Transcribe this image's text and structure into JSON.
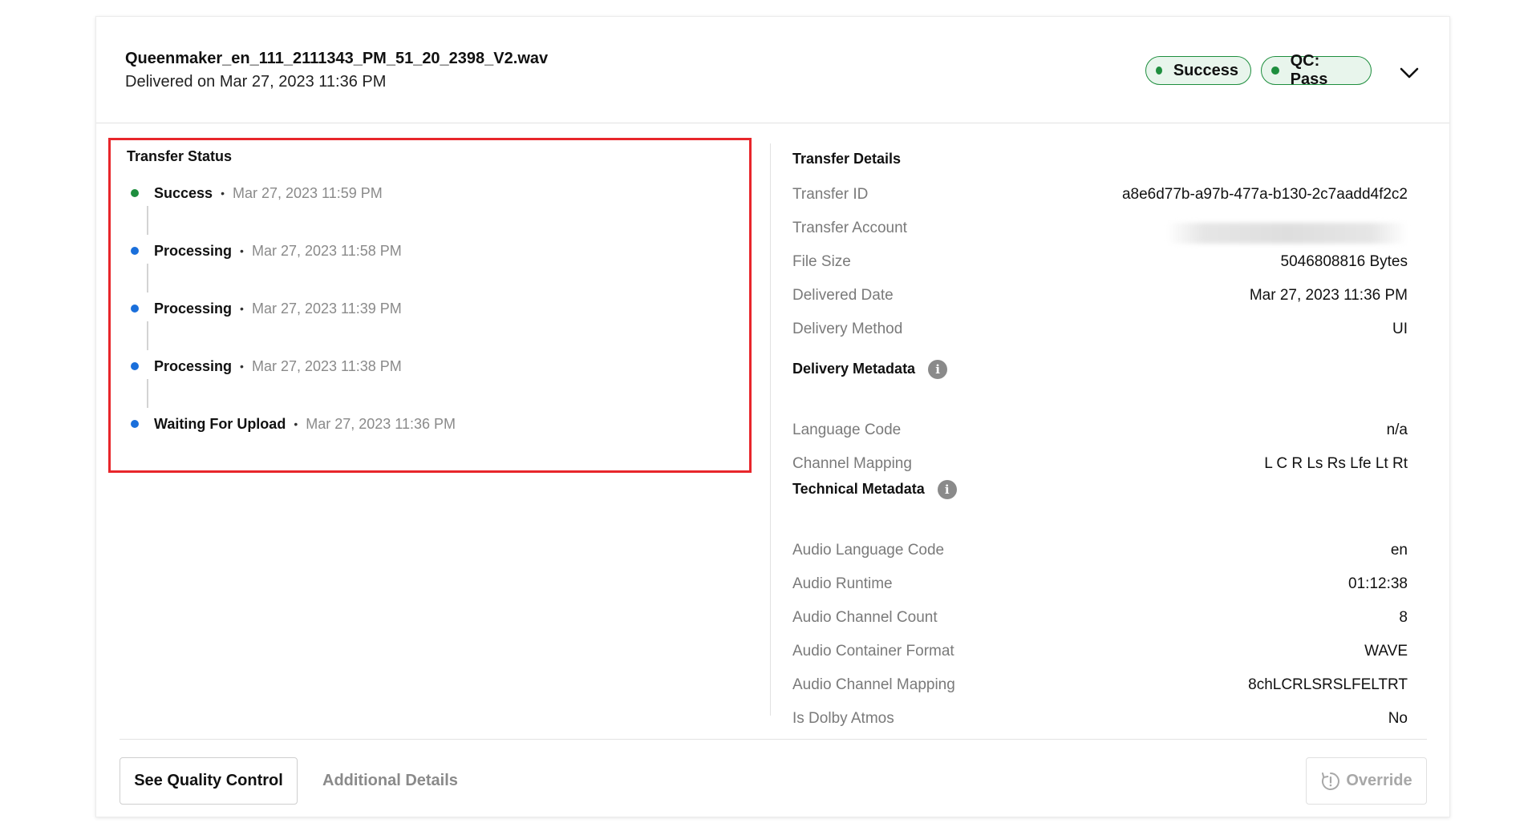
{
  "header": {
    "file_name": "Queenmaker_en_111_2111343_PM_51_20_2398_V2.wav",
    "delivered_on": "Delivered on Mar 27, 2023 11:36 PM",
    "badges": [
      {
        "label": "Success",
        "color": "#1e8e3e"
      },
      {
        "label": "QC: Pass",
        "color": "#1e8e3e"
      }
    ],
    "expand_icon": "chevron-down-icon"
  },
  "transfer_status": {
    "title": "Transfer Status",
    "items": [
      {
        "label": "Success",
        "separator": "•",
        "time": "Mar 27, 2023 11:59 PM",
        "dot_color": "#1e8e3e"
      },
      {
        "label": "Processing",
        "separator": "•",
        "time": "Mar 27, 2023 11:58 PM",
        "dot_color": "#1a6fdb"
      },
      {
        "label": "Processing",
        "separator": "•",
        "time": "Mar 27, 2023 11:39 PM",
        "dot_color": "#1a6fdb"
      },
      {
        "label": "Processing",
        "separator": "•",
        "time": "Mar 27, 2023 11:38 PM",
        "dot_color": "#1a6fdb"
      },
      {
        "label": "Waiting For Upload",
        "separator": "•",
        "time": "Mar 27, 2023 11:36 PM",
        "dot_color": "#1a6fdb"
      }
    ]
  },
  "transfer_details": {
    "title": "Transfer Details",
    "rows": [
      {
        "key": "Transfer ID",
        "value": "a8e6d77b-a97b-477a-b130-2c7aadd4f2c2"
      },
      {
        "key": "Transfer Account",
        "value": ""
      },
      {
        "key": "File Size",
        "value": "5046808816 Bytes"
      },
      {
        "key": "Delivered Date",
        "value": "Mar 27, 2023 11:36 PM"
      },
      {
        "key": "Delivery Method",
        "value": "UI"
      }
    ]
  },
  "delivery_metadata": {
    "title": "Delivery Metadata",
    "info_icon": "info-icon",
    "rows": [
      {
        "key": "Language Code",
        "value": "n/a"
      },
      {
        "key": "Channel Mapping",
        "value": "L C R Ls Rs Lfe Lt Rt"
      }
    ]
  },
  "technical_metadata": {
    "title": "Technical Metadata",
    "info_icon": "info-icon",
    "rows": [
      {
        "key": "Audio Language Code",
        "value": "en"
      },
      {
        "key": "Audio Runtime",
        "value": "01:12:38"
      },
      {
        "key": "Audio Channel Count",
        "value": "8"
      },
      {
        "key": "Audio Container Format",
        "value": "WAVE"
      },
      {
        "key": "Audio Channel Mapping",
        "value": "8chLCRLSRSLFELTRT"
      },
      {
        "key": "Is Dolby Atmos",
        "value": "No"
      }
    ]
  },
  "footer": {
    "quality_control_label": "See Quality Control",
    "additional_details_label": "Additional Details",
    "override_label": "Override",
    "override_icon": "override-icon"
  },
  "colors": {
    "highlight_border": "#e8262b",
    "success_green": "#1e8e3e",
    "processing_blue": "#1a6fdb"
  }
}
